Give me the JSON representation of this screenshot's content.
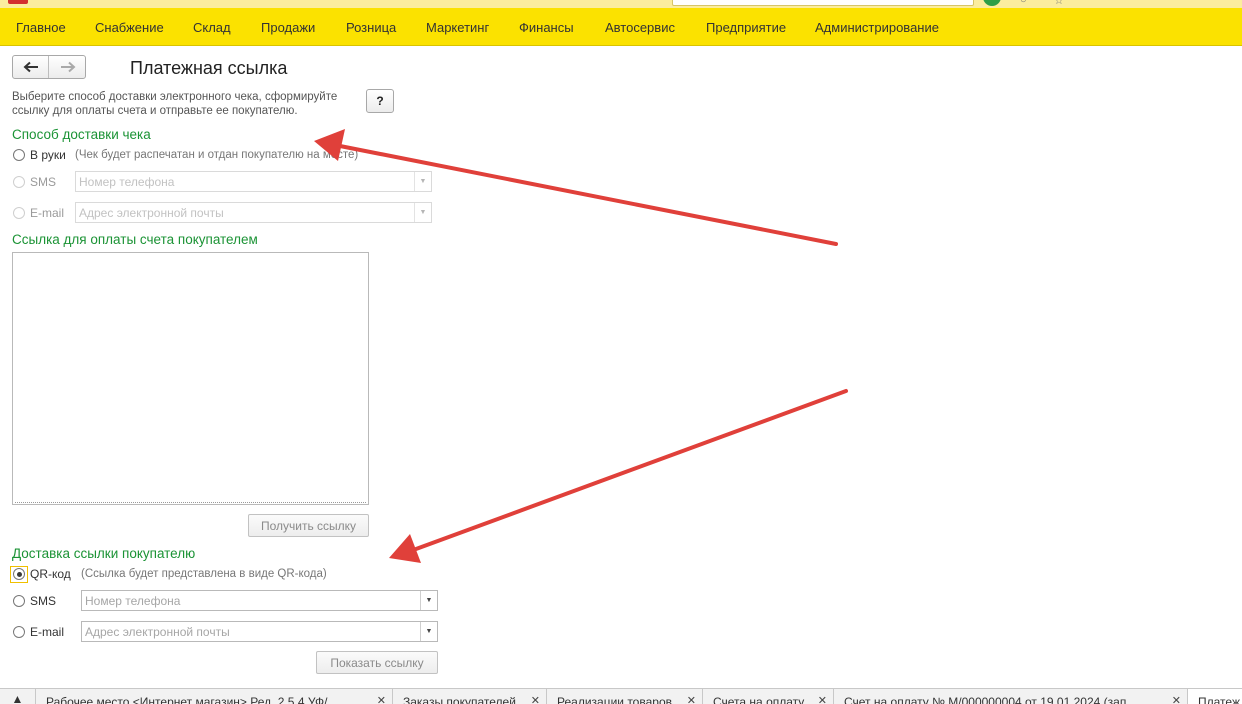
{
  "menu": {
    "items": [
      "Главное",
      "Снабжение",
      "Склад",
      "Продажи",
      "Розница",
      "Маркетинг",
      "Финансы",
      "Автосервис",
      "Предприятие",
      "Администрирование"
    ]
  },
  "form": {
    "title": "Платежная ссылка",
    "hint": "Выберите способ доставки электронного чека, сформируйте ссылку для оплаты счета и отправьте ее покупателю.",
    "help_label": "?",
    "receipt_section": "Способ доставки чека",
    "receipt_options": {
      "hand": {
        "label": "В руки",
        "note": "(Чек будет распечатан и отдан покупателю на месте)"
      },
      "sms": {
        "label": "SMS",
        "placeholder": "Номер телефона"
      },
      "email": {
        "label": "E-mail",
        "placeholder": "Адрес электронной почты"
      }
    },
    "link_section": "Ссылка для оплаты счета покупателем",
    "get_link_button": "Получить ссылку",
    "delivery_section": "Доставка ссылки покупателю",
    "delivery_options": {
      "qr": {
        "label": "QR-код",
        "note": "(Ссылка будет представлена в виде QR-кода)"
      },
      "sms": {
        "label": "SMS",
        "placeholder": "Номер телефона"
      },
      "email": {
        "label": "E-mail",
        "placeholder": "Адрес электронной почты"
      }
    },
    "show_link_button": "Показать ссылку"
  },
  "tabs": [
    "Рабочее место <Интернет магазин> Ред. 2.5.4 УФ/...",
    "Заказы покупателей",
    "Реализации товаров",
    "Счета на оплату",
    "Счет на оплату № М/000000004 от 19.01.2024 (зап...",
    "Платеж..."
  ],
  "icons": {
    "back": "arrow-left-icon",
    "forward": "arrow-right-icon",
    "home": "home-icon",
    "close": "close-icon",
    "dropdown": "dropdown-arrow-icon"
  },
  "colors": {
    "menu_bar": "#fbe200",
    "section_heading": "#1b9335",
    "annotation_arrow": "#e0403a"
  }
}
